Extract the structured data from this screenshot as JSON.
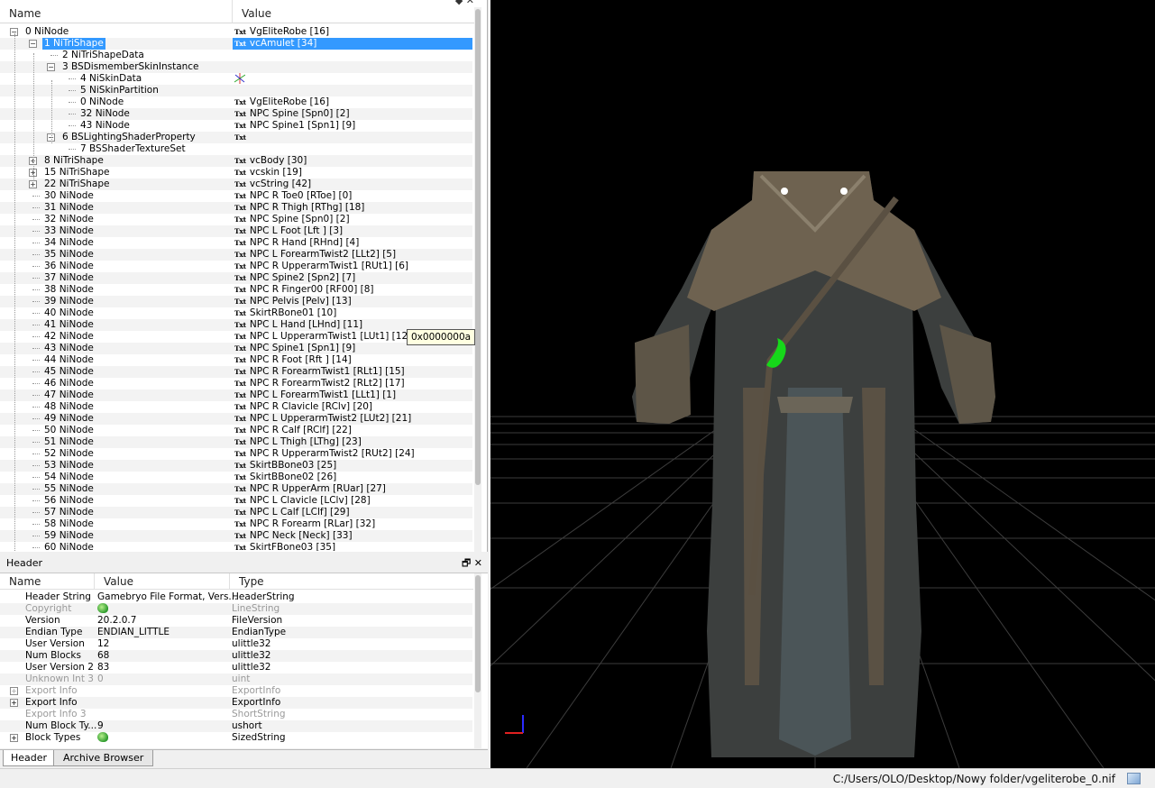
{
  "tree": {
    "col_name": "Name",
    "col_value": "Value",
    "rows": [
      {
        "name": "0 NiNode",
        "value": "VgEliteRobe [16]",
        "txt": true,
        "level": 0,
        "exp": "-"
      },
      {
        "name": "1 NiTriShape",
        "value": "vcAmulet [34]",
        "txt": true,
        "level": 1,
        "exp": "-",
        "sel": true
      },
      {
        "name": "2 NiTriShapeData",
        "value": "",
        "txt": false,
        "level": 2,
        "exp": ""
      },
      {
        "name": "3 BSDismemberSkinInstance",
        "value": "",
        "txt": false,
        "level": 2,
        "exp": "-"
      },
      {
        "name": "4 NiSkinData",
        "value": "",
        "txt": false,
        "level": 3,
        "exp": "",
        "axis": true
      },
      {
        "name": "5 NiSkinPartition",
        "value": "",
        "txt": false,
        "level": 3,
        "exp": ""
      },
      {
        "name": "0 NiNode",
        "value": "VgEliteRobe [16]",
        "txt": true,
        "level": 3,
        "exp": ""
      },
      {
        "name": "32 NiNode",
        "value": "NPC Spine [Spn0] [2]",
        "txt": true,
        "level": 3,
        "exp": ""
      },
      {
        "name": "43 NiNode",
        "value": "NPC Spine1 [Spn1] [9]",
        "txt": true,
        "level": 3,
        "exp": ""
      },
      {
        "name": "6 BSLightingShaderProperty",
        "value": "",
        "txt": true,
        "level": 2,
        "exp": "-"
      },
      {
        "name": "7 BSShaderTextureSet",
        "value": "",
        "txt": false,
        "level": 3,
        "exp": ""
      },
      {
        "name": "8 NiTriShape",
        "value": "vcBody [30]",
        "txt": true,
        "level": 1,
        "exp": "+"
      },
      {
        "name": "15 NiTriShape",
        "value": "vcskin [19]",
        "txt": true,
        "level": 1,
        "exp": "+"
      },
      {
        "name": "22 NiTriShape",
        "value": "vcString [42]",
        "txt": true,
        "level": 1,
        "exp": "+"
      },
      {
        "name": "30 NiNode",
        "value": "NPC R Toe0 [RToe] [0]",
        "txt": true,
        "level": 1,
        "exp": ""
      },
      {
        "name": "31 NiNode",
        "value": "NPC R Thigh [RThg] [18]",
        "txt": true,
        "level": 1,
        "exp": ""
      },
      {
        "name": "32 NiNode",
        "value": "NPC Spine [Spn0] [2]",
        "txt": true,
        "level": 1,
        "exp": ""
      },
      {
        "name": "33 NiNode",
        "value": "NPC L Foot [Lft ] [3]",
        "txt": true,
        "level": 1,
        "exp": ""
      },
      {
        "name": "34 NiNode",
        "value": "NPC R Hand [RHnd] [4]",
        "txt": true,
        "level": 1,
        "exp": ""
      },
      {
        "name": "35 NiNode",
        "value": "NPC L ForearmTwist2 [LLt2] [5]",
        "txt": true,
        "level": 1,
        "exp": ""
      },
      {
        "name": "36 NiNode",
        "value": "NPC R UpperarmTwist1 [RUt1] [6]",
        "txt": true,
        "level": 1,
        "exp": ""
      },
      {
        "name": "37 NiNode",
        "value": "NPC Spine2 [Spn2] [7]",
        "txt": true,
        "level": 1,
        "exp": ""
      },
      {
        "name": "38 NiNode",
        "value": "NPC R Finger00 [RF00] [8]",
        "txt": true,
        "level": 1,
        "exp": ""
      },
      {
        "name": "39 NiNode",
        "value": "NPC Pelvis [Pelv] [13]",
        "txt": true,
        "level": 1,
        "exp": ""
      },
      {
        "name": "40 NiNode",
        "value": "SkirtRBone01 [10]",
        "txt": true,
        "level": 1,
        "exp": ""
      },
      {
        "name": "41 NiNode",
        "value": "NPC L Hand [LHnd] [11]",
        "txt": true,
        "level": 1,
        "exp": ""
      },
      {
        "name": "42 NiNode",
        "value": "NPC L UpperarmTwist1 [LUt1] [12]",
        "txt": true,
        "level": 1,
        "exp": ""
      },
      {
        "name": "43 NiNode",
        "value": "NPC Spine1 [Spn1] [9]",
        "txt": true,
        "level": 1,
        "exp": ""
      },
      {
        "name": "44 NiNode",
        "value": "NPC R Foot [Rft ] [14]",
        "txt": true,
        "level": 1,
        "exp": ""
      },
      {
        "name": "45 NiNode",
        "value": "NPC R ForearmTwist1 [RLt1] [15]",
        "txt": true,
        "level": 1,
        "exp": ""
      },
      {
        "name": "46 NiNode",
        "value": "NPC R ForearmTwist2 [RLt2] [17]",
        "txt": true,
        "level": 1,
        "exp": ""
      },
      {
        "name": "47 NiNode",
        "value": "NPC L ForearmTwist1 [LLt1] [1]",
        "txt": true,
        "level": 1,
        "exp": ""
      },
      {
        "name": "48 NiNode",
        "value": "NPC R Clavicle [RClv] [20]",
        "txt": true,
        "level": 1,
        "exp": ""
      },
      {
        "name": "49 NiNode",
        "value": "NPC L UpperarmTwist2 [LUt2] [21]",
        "txt": true,
        "level": 1,
        "exp": ""
      },
      {
        "name": "50 NiNode",
        "value": "NPC R Calf [RClf] [22]",
        "txt": true,
        "level": 1,
        "exp": ""
      },
      {
        "name": "51 NiNode",
        "value": "NPC L Thigh [LThg] [23]",
        "txt": true,
        "level": 1,
        "exp": ""
      },
      {
        "name": "52 NiNode",
        "value": "NPC R UpperarmTwist2 [RUt2] [24]",
        "txt": true,
        "level": 1,
        "exp": ""
      },
      {
        "name": "53 NiNode",
        "value": "SkirtBBone03 [25]",
        "txt": true,
        "level": 1,
        "exp": ""
      },
      {
        "name": "54 NiNode",
        "value": "SkirtBBone02 [26]",
        "txt": true,
        "level": 1,
        "exp": ""
      },
      {
        "name": "55 NiNode",
        "value": "NPC R UpperArm [RUar] [27]",
        "txt": true,
        "level": 1,
        "exp": ""
      },
      {
        "name": "56 NiNode",
        "value": "NPC L Clavicle [LClv] [28]",
        "txt": true,
        "level": 1,
        "exp": ""
      },
      {
        "name": "57 NiNode",
        "value": "NPC L Calf [LClf] [29]",
        "txt": true,
        "level": 1,
        "exp": ""
      },
      {
        "name": "58 NiNode",
        "value": "NPC R Forearm [RLar] [32]",
        "txt": true,
        "level": 1,
        "exp": ""
      },
      {
        "name": "59 NiNode",
        "value": "NPC Neck [Neck] [33]",
        "txt": true,
        "level": 1,
        "exp": ""
      },
      {
        "name": "60 NiNode",
        "value": "SkirtFBone03 [35]",
        "txt": true,
        "level": 1,
        "exp": ""
      }
    ]
  },
  "tooltip": "0x0000000a",
  "txt_badge": "Txt",
  "properties": {
    "title": "Header",
    "col_name": "Name",
    "col_value": "Value",
    "col_type": "Type",
    "rows": [
      {
        "name": "Header String",
        "value": "Gamebryo File Format, Vers...",
        "type": "HeaderString",
        "gray": false,
        "exp": ""
      },
      {
        "name": "Copyright",
        "value": "",
        "type": "LineString",
        "gray": true,
        "exp": "",
        "icon": true
      },
      {
        "name": "Version",
        "value": "20.2.0.7",
        "type": "FileVersion",
        "gray": false,
        "exp": ""
      },
      {
        "name": "Endian Type",
        "value": "ENDIAN_LITTLE",
        "type": "EndianType",
        "gray": false,
        "exp": ""
      },
      {
        "name": "User Version",
        "value": "12",
        "type": "ulittle32",
        "gray": false,
        "exp": ""
      },
      {
        "name": "Num Blocks",
        "value": "68",
        "type": "ulittle32",
        "gray": false,
        "exp": ""
      },
      {
        "name": "User Version 2",
        "value": "83",
        "type": "ulittle32",
        "gray": false,
        "exp": ""
      },
      {
        "name": "Unknown Int 3",
        "value": "0",
        "type": "uint",
        "gray": true,
        "exp": ""
      },
      {
        "name": "Export Info",
        "value": "",
        "type": "ExportInfo",
        "gray": true,
        "exp": "+"
      },
      {
        "name": "Export Info",
        "value": "",
        "type": "ExportInfo",
        "gray": false,
        "exp": "+"
      },
      {
        "name": "Export Info 3",
        "value": "",
        "type": "ShortString",
        "gray": true,
        "exp": ""
      },
      {
        "name": "Num Block Ty...",
        "value": "9",
        "type": "ushort",
        "gray": false,
        "exp": ""
      },
      {
        "name": "Block Types",
        "value": "",
        "type": "SizedString",
        "gray": false,
        "exp": "+",
        "icon": true
      }
    ]
  },
  "tabs": {
    "header": "Header",
    "archive": "Archive Browser"
  },
  "status": {
    "path": "C:/Users/OLO/Desktop/Nowy folder/vgeliterobe_0.nif"
  }
}
